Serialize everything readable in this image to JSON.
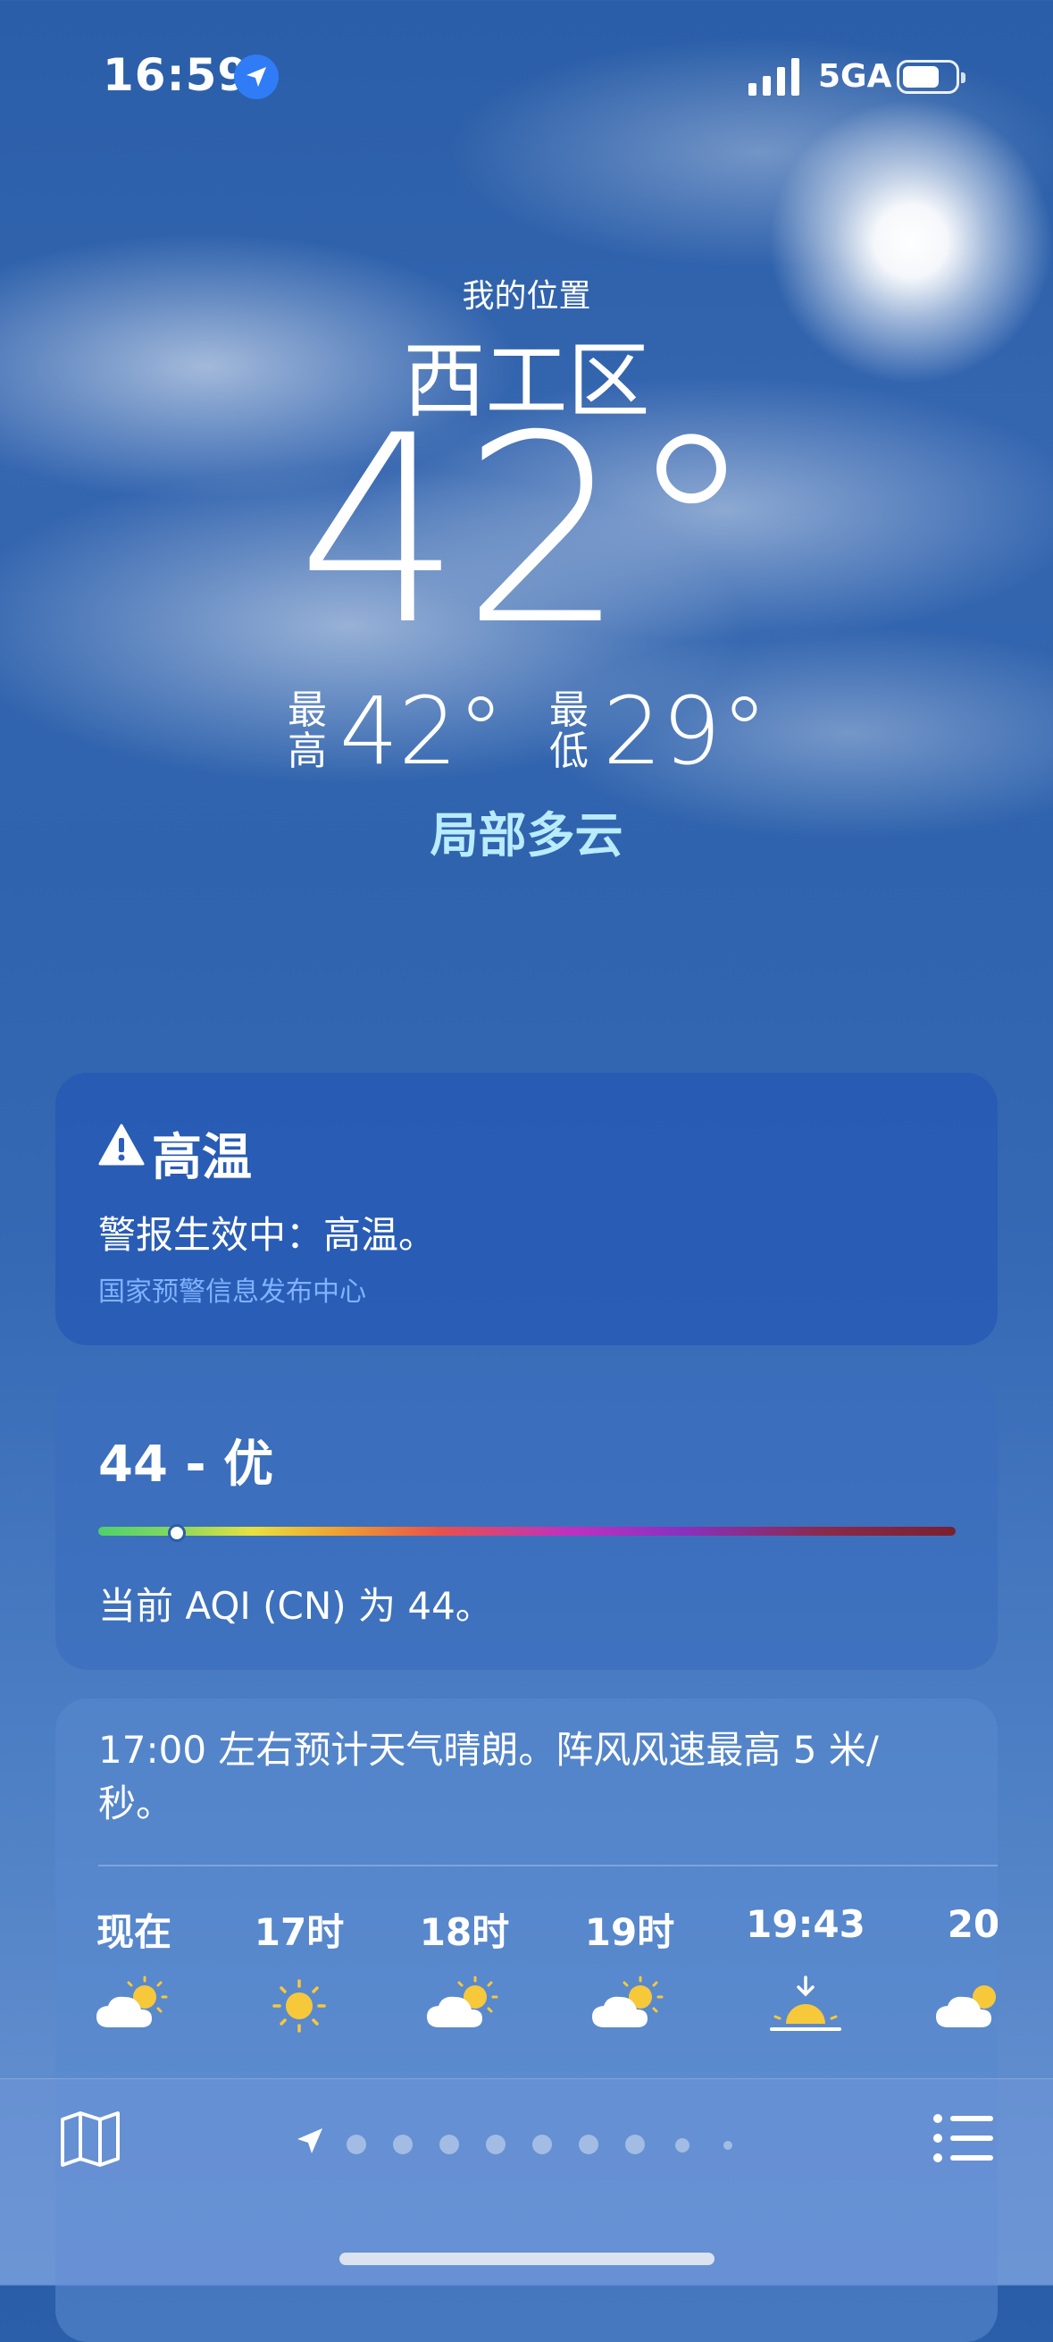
{
  "status_bar": {
    "time": "16:59",
    "network": "5GA"
  },
  "header": {
    "my_location": "我的位置",
    "city": "西工区",
    "temperature": "42°",
    "high_label": "最高",
    "high": "42°",
    "low_label": "最低",
    "low": "29°",
    "condition": "局部多云"
  },
  "alert": {
    "title": "高温",
    "text": "警报生效中：高温。",
    "source": "国家预警信息发布中心"
  },
  "aqi": {
    "title": "44 - 优",
    "description": "当前 AQI (CN) 为 44。",
    "value": 44
  },
  "forecast": {
    "summary": "17:00 左右预计天气晴朗。阵风风速最高 5 米/秒。",
    "hours": [
      {
        "label": "现在",
        "icon": "partly-cloudy-icon"
      },
      {
        "label": "17时",
        "icon": "sun-icon"
      },
      {
        "label": "18时",
        "icon": "partly-cloudy-icon"
      },
      {
        "label": "19时",
        "icon": "partly-cloudy-icon"
      },
      {
        "label": "19:43",
        "icon": "sunset-icon"
      },
      {
        "label": "20",
        "icon": "partly-cloudy-icon"
      }
    ]
  },
  "bottom_bar": {
    "pages": 9,
    "current_page": 0
  },
  "colors": {
    "condition": "#b9ecff",
    "alert_source": "#7fb2ff",
    "location_badge": "#2f7cf6"
  }
}
